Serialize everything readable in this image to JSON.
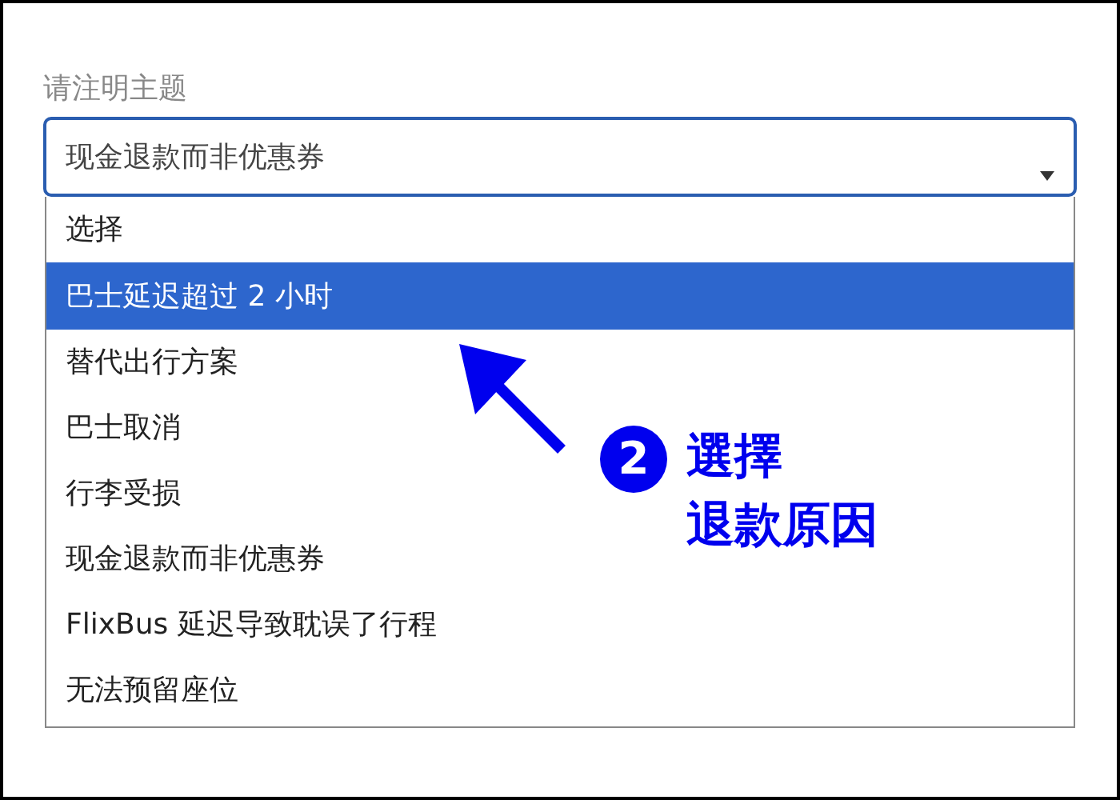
{
  "field": {
    "label": "请注明主题",
    "value": "现金退款而非优惠券"
  },
  "options": [
    {
      "label": "选择",
      "selected": false
    },
    {
      "label": "巴士延迟超过 2 小时",
      "selected": true
    },
    {
      "label": "替代出行方案",
      "selected": false
    },
    {
      "label": "巴士取消",
      "selected": false
    },
    {
      "label": "行李受损",
      "selected": false
    },
    {
      "label": "现金退款而非优惠券",
      "selected": false
    },
    {
      "label": "FlixBus 延迟导致耽误了行程",
      "selected": false
    },
    {
      "label": "无法预留座位",
      "selected": false
    }
  ],
  "annotation": {
    "step": "2",
    "lines": [
      "選擇",
      "退款原因"
    ]
  }
}
